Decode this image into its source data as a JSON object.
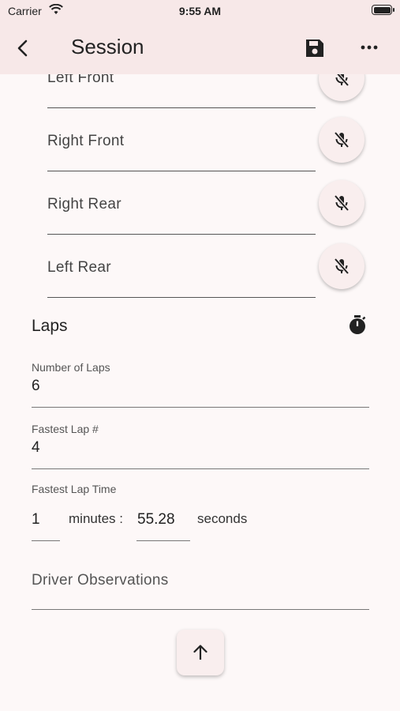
{
  "status_bar": {
    "carrier": "Carrier",
    "time": "9:55 AM"
  },
  "app_bar": {
    "title": "Session",
    "icons": [
      "back-arrow",
      "save-disk",
      "more-horizontal"
    ]
  },
  "tires": [
    {
      "label": "Left Front",
      "icon": "mic-off"
    },
    {
      "label": "Right Front",
      "icon": "mic-off"
    },
    {
      "label": "Right Rear",
      "icon": "mic-off"
    },
    {
      "label": "Left Rear",
      "icon": "mic-off"
    }
  ],
  "laps": {
    "heading": "Laps",
    "icon": "timer",
    "number_of_laps": {
      "label": "Number of Laps",
      "value": "6"
    },
    "fastest_lap": {
      "label": "Fastest Lap #",
      "value": "4"
    },
    "fastest_lap_time": {
      "label": "Fastest Lap Time",
      "minutes_value": "1",
      "minutes_label": "minutes :",
      "seconds_value": "55.28",
      "seconds_label": "seconds"
    }
  },
  "observations": {
    "placeholder": "Driver Observations"
  },
  "scroll_top_icon": "arrow-up",
  "colors": {
    "app_bar_bg": "#f7e8e8",
    "page_bg": "#fdf8f8",
    "button_bg": "#f9eeee"
  }
}
